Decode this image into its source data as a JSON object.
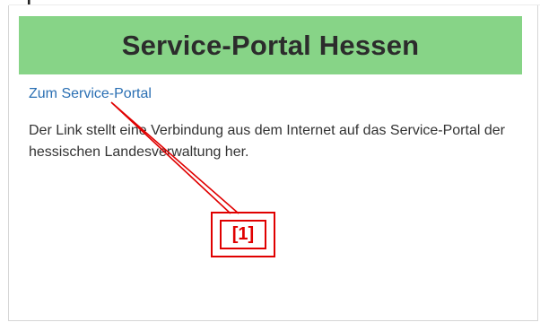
{
  "header_fragment": "]",
  "panel": {
    "title": "Service-Portal Hessen",
    "header_color": "#87d487",
    "link_text": "Zum Service-Portal",
    "description": "Der Link stellt eine Verbindung aus dem Internet auf das Service-Portal der hessischen Landesverwaltung her."
  },
  "annotation": {
    "label": "[1]",
    "color": "#e00000"
  }
}
